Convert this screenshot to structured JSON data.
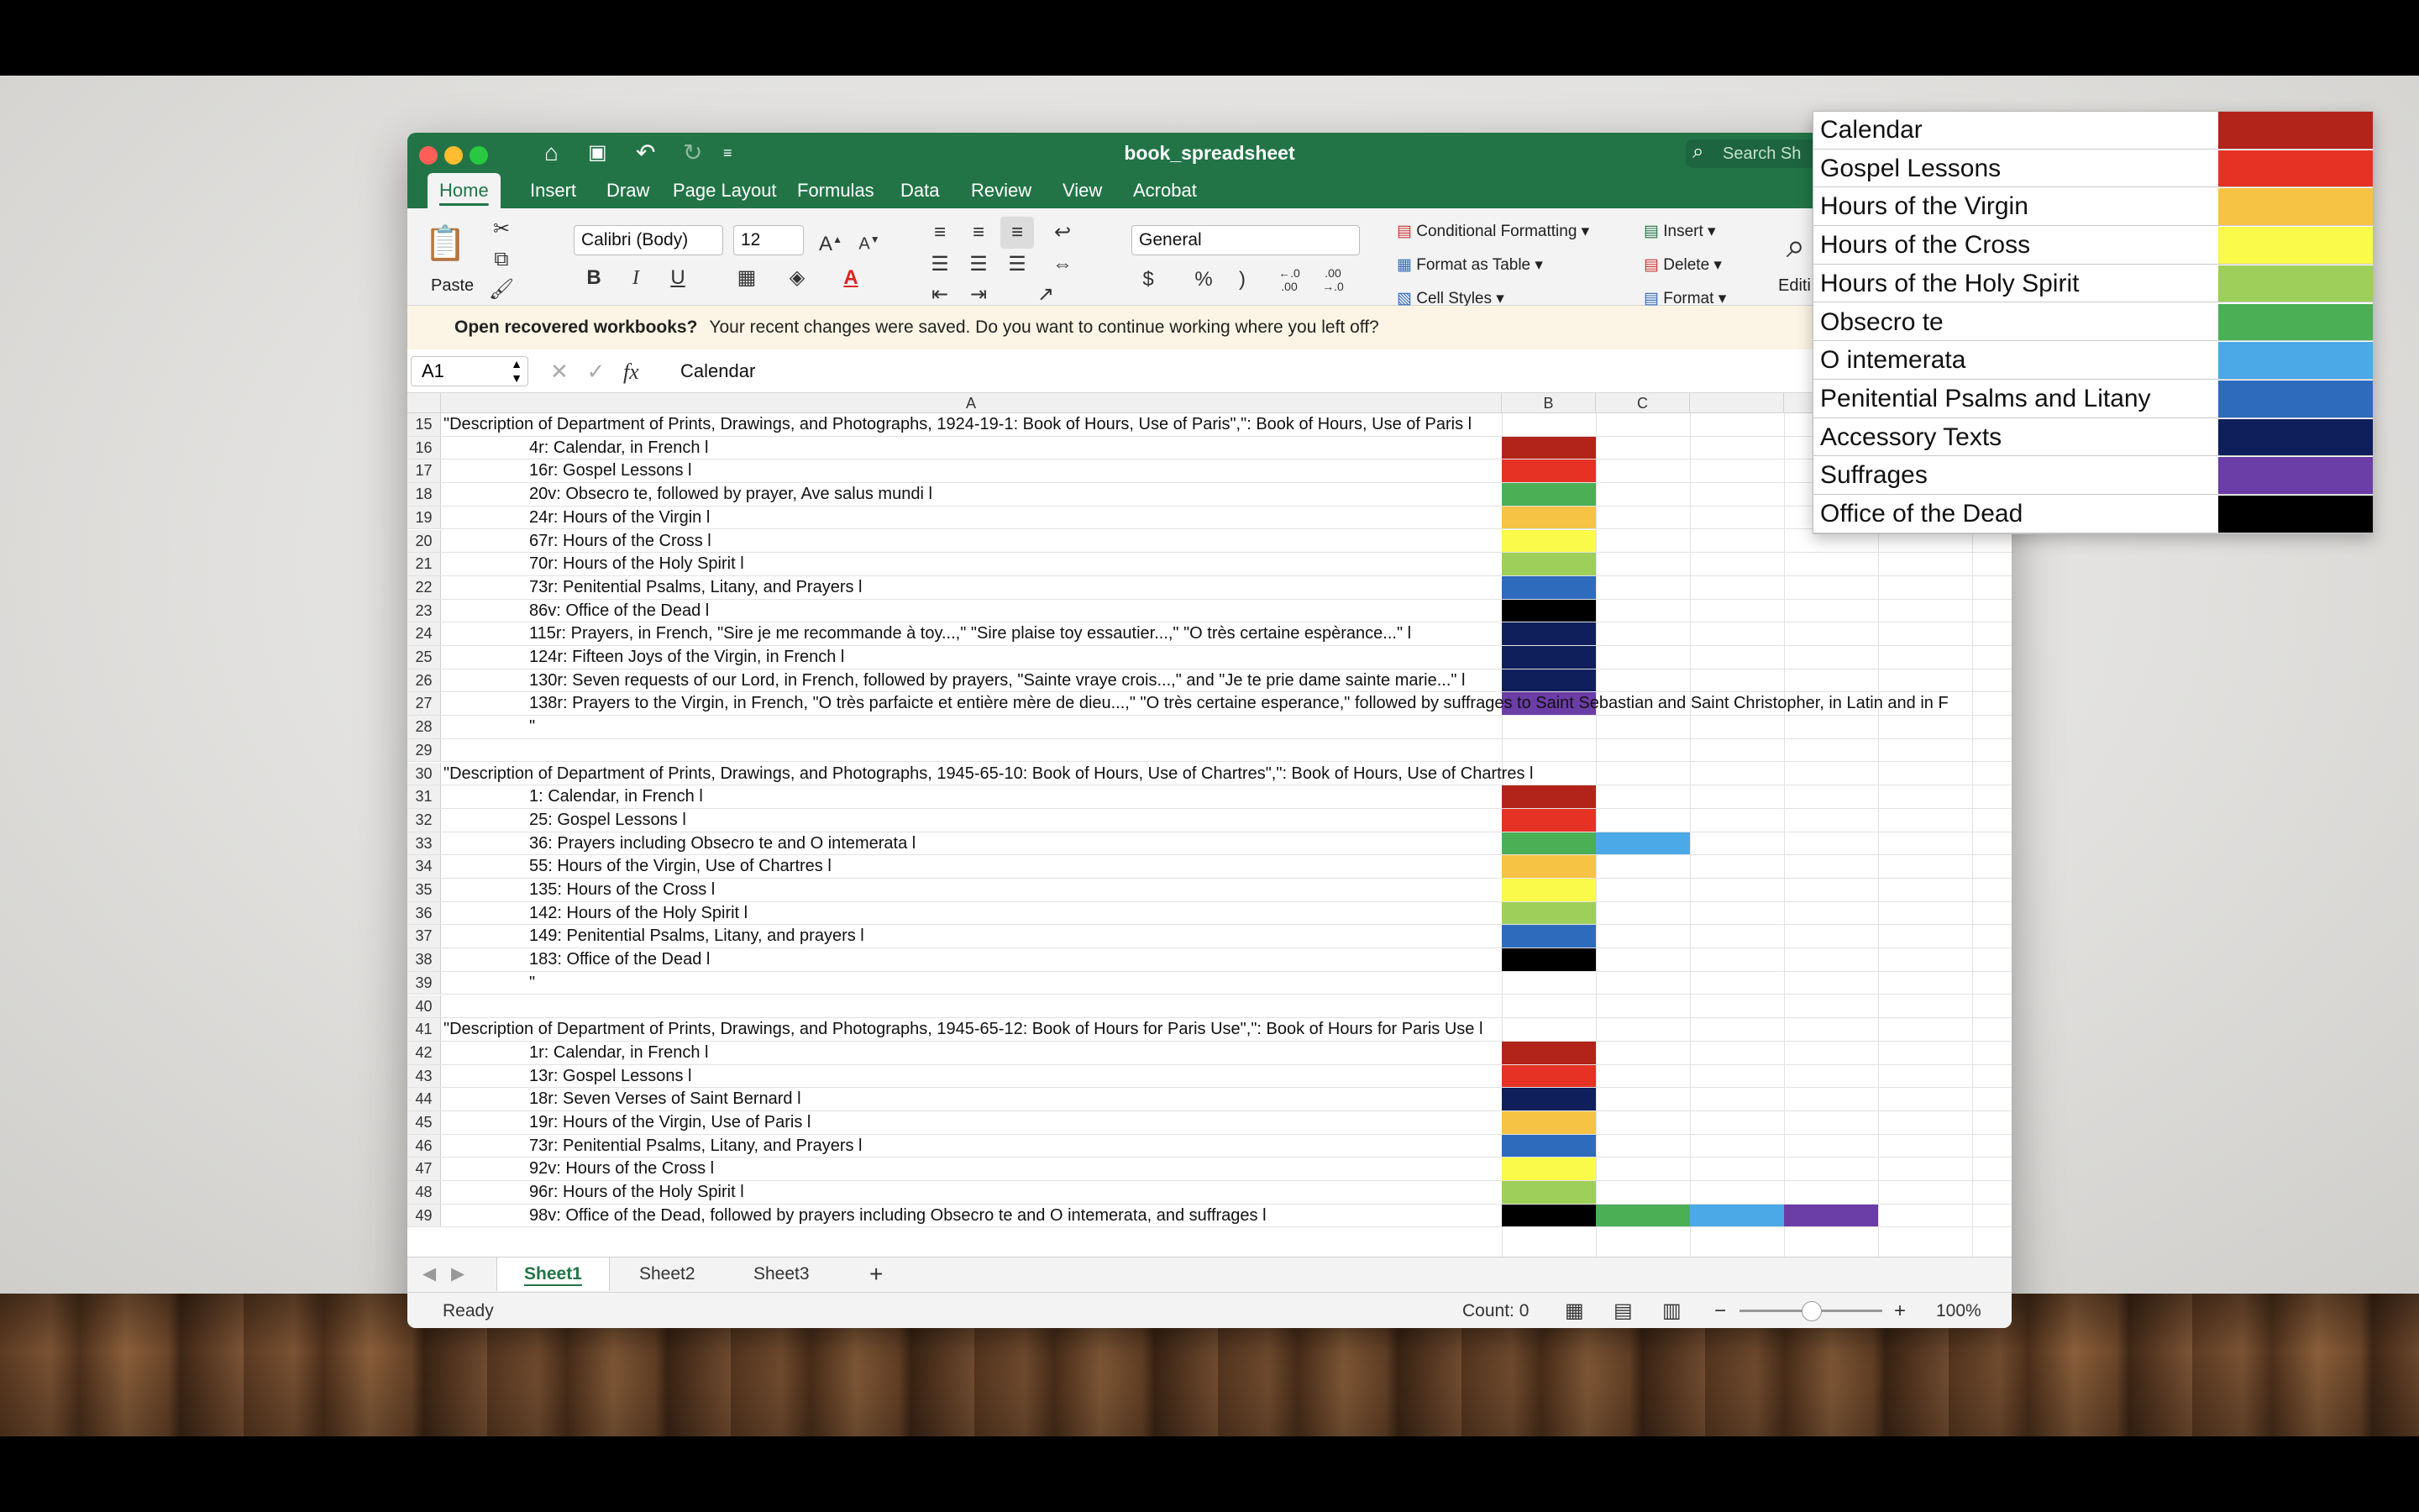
{
  "window": {
    "title": "book_spreadsheet",
    "search_placeholder": "Search Sh"
  },
  "tabs": [
    "Home",
    "Insert",
    "Draw",
    "Page Layout",
    "Formulas",
    "Data",
    "Review",
    "View",
    "Acrobat"
  ],
  "ribbon": {
    "paste": "Paste",
    "font_name": "Calibri (Body)",
    "font_size": "12",
    "bold": "B",
    "italic": "I",
    "underline": "U",
    "number_format": "General",
    "currency": "$",
    "percent": "%",
    "comma": ")",
    "inc_decimal": "←.0\n.00",
    "dec_decimal": ".00\n→.0",
    "conditional_formatting": "Conditional Formatting",
    "format_as_table": "Format as Table",
    "cell_styles": "Cell Styles",
    "insert": "Insert",
    "delete": "Delete",
    "format": "Format",
    "editing": "Editi"
  },
  "notice": {
    "title": "Open recovered workbooks?",
    "message": "Your recent changes were saved. Do you want to continue working where you left off?"
  },
  "formula_bar": {
    "name_box": "A1",
    "fx": "fx",
    "value": "Calendar"
  },
  "columns": [
    "A",
    "B",
    "C"
  ],
  "colors": {
    "calendar": "#b22319",
    "gospel": "#e63225",
    "virgin": "#f7c345",
    "cross": "#fafa4a",
    "spirit": "#9ecf5a",
    "obsecro": "#4aaf55",
    "intemerata": "#4ba9e8",
    "penitential": "#2f6bbd",
    "accessory": "#0e1f5b",
    "suffrages": "#6b3da6",
    "dead": "#000000"
  },
  "rows": [
    {
      "n": "15",
      "text": "\"Description of Department of Prints, Drawings, and Photographs, 1924-19-1: Book of Hours, Use of Paris\",\": Book of Hours, Use of Paris l",
      "indent": false,
      "fills": []
    },
    {
      "n": "16",
      "text": "4r: Calendar, in French l",
      "indent": true,
      "fills": [
        "calendar"
      ]
    },
    {
      "n": "17",
      "text": "16r: Gospel Lessons l",
      "indent": true,
      "fills": [
        "gospel"
      ]
    },
    {
      "n": "18",
      "text": "20v: Obsecro te, followed by prayer, Ave salus mundi l",
      "indent": true,
      "fills": [
        "obsecro"
      ]
    },
    {
      "n": "19",
      "text": "24r: Hours of the Virgin l",
      "indent": true,
      "fills": [
        "virgin"
      ]
    },
    {
      "n": "20",
      "text": "67r: Hours of the Cross l",
      "indent": true,
      "fills": [
        "cross"
      ]
    },
    {
      "n": "21",
      "text": "70r: Hours of the Holy Spirit l",
      "indent": true,
      "fills": [
        "spirit"
      ]
    },
    {
      "n": "22",
      "text": "73r: Penitential Psalms, Litany, and Prayers l",
      "indent": true,
      "fills": [
        "penitential"
      ]
    },
    {
      "n": "23",
      "text": "86v: Office of the Dead l",
      "indent": true,
      "fills": [
        "dead"
      ]
    },
    {
      "n": "24",
      "text": "115r: Prayers, in French, \"Sire je me recommande à toy...,\" \"Sire plaise toy essautier...,\" \"O très certaine espèrance...\" l",
      "indent": true,
      "fills": [
        "accessory"
      ]
    },
    {
      "n": "25",
      "text": "124r: Fifteen Joys of the Virgin, in French l",
      "indent": true,
      "fills": [
        "accessory"
      ]
    },
    {
      "n": "26",
      "text": "130r: Seven requests of our Lord, in French, followed by prayers, \"Sainte vraye crois...,\" and \"Je te prie dame sainte marie...\" l",
      "indent": true,
      "fills": [
        "accessory"
      ]
    },
    {
      "n": "27",
      "text": "138r: Prayers to the Virgin, in French, \"O très parfaicte et entière mère de dieu...,\" \"O très certaine esperance,\" followed by suffrages to Saint Sebastian and Saint Christopher, in Latin and in F",
      "indent": true,
      "fills": [
        "suffrages"
      ]
    },
    {
      "n": "28",
      "text": "\"",
      "indent": true,
      "fills": []
    },
    {
      "n": "29",
      "text": "",
      "indent": false,
      "fills": []
    },
    {
      "n": "30",
      "text": "\"Description of Department of Prints, Drawings, and Photographs, 1945-65-10: Book of Hours, Use of Chartres\",\": Book of Hours, Use of Chartres l",
      "indent": false,
      "fills": []
    },
    {
      "n": "31",
      "text": "1: Calendar, in French l",
      "indent": true,
      "fills": [
        "calendar"
      ]
    },
    {
      "n": "32",
      "text": "25: Gospel Lessons l",
      "indent": true,
      "fills": [
        "gospel"
      ]
    },
    {
      "n": "33",
      "text": "36: Prayers including Obsecro te and O intemerata l",
      "indent": true,
      "fills": [
        "obsecro",
        "intemerata"
      ]
    },
    {
      "n": "34",
      "text": "55: Hours of the Virgin, Use of Chartres l",
      "indent": true,
      "fills": [
        "virgin"
      ]
    },
    {
      "n": "35",
      "text": "135: Hours of the Cross l",
      "indent": true,
      "fills": [
        "cross"
      ]
    },
    {
      "n": "36",
      "text": "142: Hours of the Holy Spirit l",
      "indent": true,
      "fills": [
        "spirit"
      ]
    },
    {
      "n": "37",
      "text": "149: Penitential Psalms, Litany, and prayers l",
      "indent": true,
      "fills": [
        "penitential"
      ]
    },
    {
      "n": "38",
      "text": "183: Office of the Dead l",
      "indent": true,
      "fills": [
        "dead"
      ]
    },
    {
      "n": "39",
      "text": "\"",
      "indent": true,
      "fills": []
    },
    {
      "n": "40",
      "text": "",
      "indent": false,
      "fills": []
    },
    {
      "n": "41",
      "text": "\"Description of Department of Prints, Drawings, and Photographs, 1945-65-12: Book of Hours for Paris Use\",\": Book of Hours for Paris Use l",
      "indent": false,
      "fills": []
    },
    {
      "n": "42",
      "text": "1r: Calendar, in French l",
      "indent": true,
      "fills": [
        "calendar"
      ]
    },
    {
      "n": "43",
      "text": "13r: Gospel Lessons l",
      "indent": true,
      "fills": [
        "gospel"
      ]
    },
    {
      "n": "44",
      "text": "18r: Seven Verses of Saint Bernard l",
      "indent": true,
      "fills": [
        "accessory"
      ]
    },
    {
      "n": "45",
      "text": "19r: Hours of the Virgin, Use of Paris l",
      "indent": true,
      "fills": [
        "virgin"
      ]
    },
    {
      "n": "46",
      "text": "73r: Penitential Psalms, Litany, and Prayers l",
      "indent": true,
      "fills": [
        "penitential"
      ]
    },
    {
      "n": "47",
      "text": "92v: Hours of the Cross l",
      "indent": true,
      "fills": [
        "cross"
      ]
    },
    {
      "n": "48",
      "text": "96r: Hours of the Holy Spirit l",
      "indent": true,
      "fills": [
        "spirit"
      ]
    },
    {
      "n": "49",
      "text": "98v: Office of the Dead, followed by prayers including Obsecro te and O intemerata, and suffrages l",
      "indent": true,
      "fills": [
        "dead",
        "obsecro",
        "intemerata",
        "suffrages"
      ]
    }
  ],
  "sheets": [
    "Sheet1",
    "Sheet2",
    "Sheet3"
  ],
  "add_sheet": "+",
  "status": {
    "ready": "Ready",
    "count": "Count: 0",
    "zoom": "100%"
  },
  "legend": [
    {
      "label": "Calendar",
      "color": "calendar"
    },
    {
      "label": "Gospel Lessons",
      "color": "gospel"
    },
    {
      "label": "Hours of the Virgin",
      "color": "virgin"
    },
    {
      "label": "Hours of the Cross",
      "color": "cross"
    },
    {
      "label": "Hours of the Holy Spirit",
      "color": "spirit"
    },
    {
      "label": "Obsecro te",
      "color": "obsecro"
    },
    {
      "label": "O intemerata",
      "color": "intemerata"
    },
    {
      "label": "Penitential Psalms and Litany",
      "color": "penitential"
    },
    {
      "label": "Accessory Texts",
      "color": "accessory"
    },
    {
      "label": "Suffrages",
      "color": "suffrages"
    },
    {
      "label": "Office of the Dead",
      "color": "dead"
    }
  ]
}
